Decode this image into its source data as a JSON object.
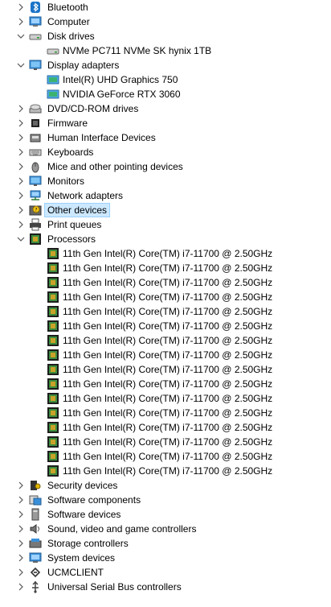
{
  "tree": [
    {
      "depth": 0,
      "state": "collapsed",
      "icon": "bluetooth-icon",
      "label": "Bluetooth"
    },
    {
      "depth": 0,
      "state": "collapsed",
      "icon": "computer-icon",
      "label": "Computer"
    },
    {
      "depth": 0,
      "state": "expanded",
      "icon": "disk-drive-icon",
      "label": "Disk drives"
    },
    {
      "depth": 1,
      "state": "leaf",
      "icon": "disk-drive-icon",
      "label": "NVMe PC711 NVMe SK hynix 1TB"
    },
    {
      "depth": 0,
      "state": "expanded",
      "icon": "monitor-icon",
      "label": "Display adapters"
    },
    {
      "depth": 1,
      "state": "leaf",
      "icon": "display-adapter-icon",
      "label": "Intel(R) UHD Graphics 750"
    },
    {
      "depth": 1,
      "state": "leaf",
      "icon": "display-adapter-icon",
      "label": "NVIDIA GeForce RTX 3060"
    },
    {
      "depth": 0,
      "state": "collapsed",
      "icon": "dvd-drive-icon",
      "label": "DVD/CD-ROM drives"
    },
    {
      "depth": 0,
      "state": "collapsed",
      "icon": "chip-icon",
      "label": "Firmware"
    },
    {
      "depth": 0,
      "state": "collapsed",
      "icon": "hid-icon",
      "label": "Human Interface Devices"
    },
    {
      "depth": 0,
      "state": "collapsed",
      "icon": "keyboard-icon",
      "label": "Keyboards"
    },
    {
      "depth": 0,
      "state": "collapsed",
      "icon": "mouse-icon",
      "label": "Mice and other pointing devices"
    },
    {
      "depth": 0,
      "state": "collapsed",
      "icon": "monitor-icon",
      "label": "Monitors"
    },
    {
      "depth": 0,
      "state": "collapsed",
      "icon": "network-icon",
      "label": "Network adapters"
    },
    {
      "depth": 0,
      "state": "collapsed",
      "icon": "unknown-device-icon",
      "label": "Other devices",
      "selected": true
    },
    {
      "depth": 0,
      "state": "collapsed",
      "icon": "printer-icon",
      "label": "Print queues"
    },
    {
      "depth": 0,
      "state": "expanded",
      "icon": "processor-icon",
      "label": "Processors"
    },
    {
      "depth": 1,
      "state": "leaf",
      "icon": "processor-icon",
      "label": "11th Gen Intel(R) Core(TM) i7-11700 @ 2.50GHz"
    },
    {
      "depth": 1,
      "state": "leaf",
      "icon": "processor-icon",
      "label": "11th Gen Intel(R) Core(TM) i7-11700 @ 2.50GHz"
    },
    {
      "depth": 1,
      "state": "leaf",
      "icon": "processor-icon",
      "label": "11th Gen Intel(R) Core(TM) i7-11700 @ 2.50GHz"
    },
    {
      "depth": 1,
      "state": "leaf",
      "icon": "processor-icon",
      "label": "11th Gen Intel(R) Core(TM) i7-11700 @ 2.50GHz"
    },
    {
      "depth": 1,
      "state": "leaf",
      "icon": "processor-icon",
      "label": "11th Gen Intel(R) Core(TM) i7-11700 @ 2.50GHz"
    },
    {
      "depth": 1,
      "state": "leaf",
      "icon": "processor-icon",
      "label": "11th Gen Intel(R) Core(TM) i7-11700 @ 2.50GHz"
    },
    {
      "depth": 1,
      "state": "leaf",
      "icon": "processor-icon",
      "label": "11th Gen Intel(R) Core(TM) i7-11700 @ 2.50GHz"
    },
    {
      "depth": 1,
      "state": "leaf",
      "icon": "processor-icon",
      "label": "11th Gen Intel(R) Core(TM) i7-11700 @ 2.50GHz"
    },
    {
      "depth": 1,
      "state": "leaf",
      "icon": "processor-icon",
      "label": "11th Gen Intel(R) Core(TM) i7-11700 @ 2.50GHz"
    },
    {
      "depth": 1,
      "state": "leaf",
      "icon": "processor-icon",
      "label": "11th Gen Intel(R) Core(TM) i7-11700 @ 2.50GHz"
    },
    {
      "depth": 1,
      "state": "leaf",
      "icon": "processor-icon",
      "label": "11th Gen Intel(R) Core(TM) i7-11700 @ 2.50GHz"
    },
    {
      "depth": 1,
      "state": "leaf",
      "icon": "processor-icon",
      "label": "11th Gen Intel(R) Core(TM) i7-11700 @ 2.50GHz"
    },
    {
      "depth": 1,
      "state": "leaf",
      "icon": "processor-icon",
      "label": "11th Gen Intel(R) Core(TM) i7-11700 @ 2.50GHz"
    },
    {
      "depth": 1,
      "state": "leaf",
      "icon": "processor-icon",
      "label": "11th Gen Intel(R) Core(TM) i7-11700 @ 2.50GHz"
    },
    {
      "depth": 1,
      "state": "leaf",
      "icon": "processor-icon",
      "label": "11th Gen Intel(R) Core(TM) i7-11700 @ 2.50GHz"
    },
    {
      "depth": 1,
      "state": "leaf",
      "icon": "processor-icon",
      "label": "11th Gen Intel(R) Core(TM) i7-11700 @ 2.50GHz"
    },
    {
      "depth": 0,
      "state": "collapsed",
      "icon": "security-icon",
      "label": "Security devices"
    },
    {
      "depth": 0,
      "state": "collapsed",
      "icon": "software-component-icon",
      "label": "Software components"
    },
    {
      "depth": 0,
      "state": "collapsed",
      "icon": "software-device-icon",
      "label": "Software devices"
    },
    {
      "depth": 0,
      "state": "collapsed",
      "icon": "speaker-icon",
      "label": "Sound, video and game controllers"
    },
    {
      "depth": 0,
      "state": "collapsed",
      "icon": "storage-controller-icon",
      "label": "Storage controllers"
    },
    {
      "depth": 0,
      "state": "collapsed",
      "icon": "system-device-icon",
      "label": "System devices"
    },
    {
      "depth": 0,
      "state": "collapsed",
      "icon": "ucm-client-icon",
      "label": "UCMCLIENT"
    },
    {
      "depth": 0,
      "state": "collapsed",
      "icon": "usb-icon",
      "label": "Universal Serial Bus controllers"
    }
  ],
  "colors": {
    "selection_bg": "#cce8ff",
    "selection_border": "#99d1ff",
    "chevron": "#555555",
    "text": "#000000"
  }
}
